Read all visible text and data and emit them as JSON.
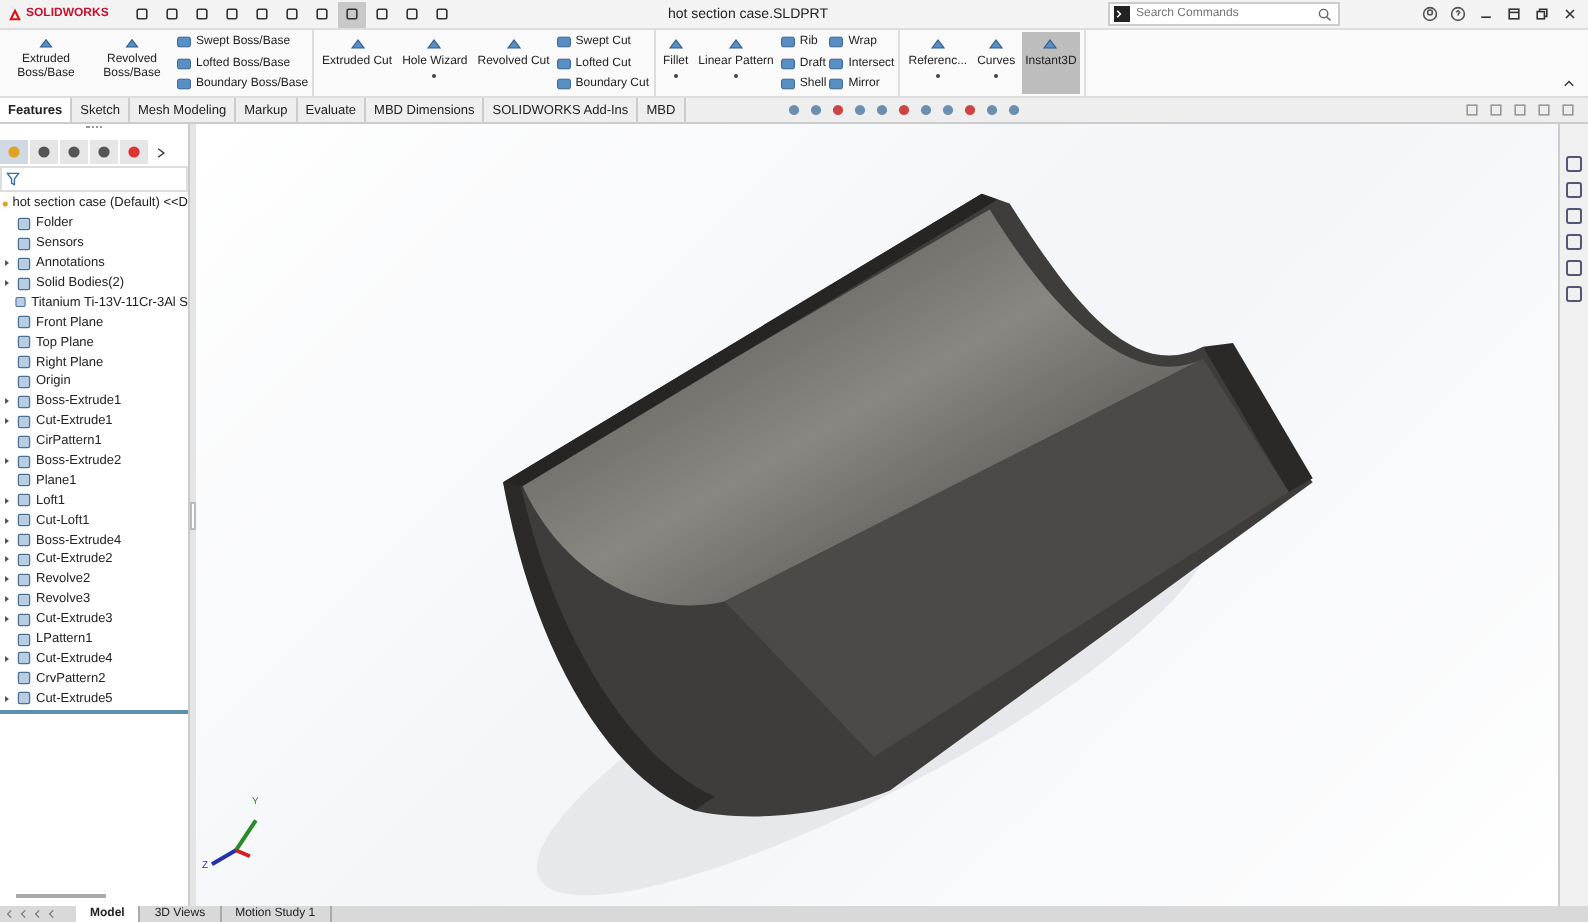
{
  "app": {
    "logo": "SOLIDWORKS"
  },
  "window": {
    "title": "hot section case.SLDPRT"
  },
  "quick_access": [
    {
      "selected": false
    },
    {
      "selected": false
    },
    {
      "selected": false
    },
    {
      "selected": false
    },
    {
      "selected": false
    },
    {
      "selected": false
    },
    {
      "selected": false
    },
    {
      "selected": true
    },
    {
      "selected": false
    },
    {
      "selected": false
    },
    {
      "selected": false
    }
  ],
  "search": {
    "placeholder": "Search Commands"
  },
  "ribbon": {
    "groups": [
      {
        "large": [
          {
            "label": "Extruded Boss/Base",
            "dropdown": false,
            "on": false
          },
          {
            "label": "Revolved Boss/Base",
            "dropdown": false,
            "on": false
          }
        ],
        "stacks": [
          [
            "Swept Boss/Base",
            "Lofted Boss/Base",
            "Boundary Boss/Base"
          ]
        ]
      },
      {
        "large": [
          {
            "label": "Extruded Cut",
            "dropdown": false,
            "on": false
          },
          {
            "label": "Hole Wizard",
            "dropdown": true,
            "on": false
          },
          {
            "label": "Revolved Cut",
            "dropdown": false,
            "on": false
          }
        ],
        "stacks": [
          [
            "Swept Cut",
            "Lofted Cut",
            "Boundary Cut"
          ]
        ]
      },
      {
        "large": [
          {
            "label": "Fillet",
            "dropdown": true,
            "on": false
          },
          {
            "label": "Linear Pattern",
            "dropdown": true,
            "on": false
          }
        ],
        "stacks": [
          [
            "Rib",
            "Draft",
            "Shell"
          ],
          [
            "Wrap",
            "Intersect",
            "Mirror"
          ]
        ]
      },
      {
        "large": [
          {
            "label": "Referenc...",
            "dropdown": true,
            "on": false
          },
          {
            "label": "Curves",
            "dropdown": true,
            "on": false
          },
          {
            "label": "Instant3D",
            "dropdown": false,
            "on": true
          }
        ]
      }
    ]
  },
  "command_tabs": [
    {
      "label": "Features",
      "selected": true
    },
    {
      "label": "Sketch",
      "selected": false
    },
    {
      "label": "Mesh Modeling",
      "selected": false
    },
    {
      "label": "Markup",
      "selected": false
    },
    {
      "label": "Evaluate",
      "selected": false
    },
    {
      "label": "MBD Dimensions",
      "selected": false
    },
    {
      "label": "SOLIDWORKS Add-Ins",
      "selected": false
    },
    {
      "label": "MBD",
      "selected": false
    }
  ],
  "panel_tabs": [
    {
      "selected": true
    },
    {
      "selected": false
    },
    {
      "selected": false
    },
    {
      "selected": false
    },
    {
      "selected": false
    }
  ],
  "feature_tree": {
    "root": "hot section case (Default) <<D",
    "items": [
      {
        "label": "Folder",
        "expandable": false
      },
      {
        "label": "Sensors",
        "expandable": false
      },
      {
        "label": "Annotations",
        "expandable": true
      },
      {
        "label": "Solid Bodies(2)",
        "expandable": true
      },
      {
        "label": "Titanium Ti-13V-11Cr-3Al S",
        "expandable": false
      },
      {
        "label": "Front Plane",
        "expandable": false
      },
      {
        "label": "Top Plane",
        "expandable": false
      },
      {
        "label": "Right Plane",
        "expandable": false
      },
      {
        "label": "Origin",
        "expandable": false
      },
      {
        "label": "Boss-Extrude1",
        "expandable": true
      },
      {
        "label": "Cut-Extrude1",
        "expandable": true
      },
      {
        "label": "CirPattern1",
        "expandable": false
      },
      {
        "label": "Boss-Extrude2",
        "expandable": true
      },
      {
        "label": "Plane1",
        "expandable": false
      },
      {
        "label": "Loft1",
        "expandable": true
      },
      {
        "label": "Cut-Loft1",
        "expandable": true
      },
      {
        "label": "Boss-Extrude4",
        "expandable": true
      },
      {
        "label": "Cut-Extrude2",
        "expandable": true
      },
      {
        "label": "Revolve2",
        "expandable": true
      },
      {
        "label": "Revolve3",
        "expandable": true
      },
      {
        "label": "Cut-Extrude3",
        "expandable": true
      },
      {
        "label": "LPattern1",
        "expandable": false
      },
      {
        "label": "Cut-Extrude4",
        "expandable": true
      },
      {
        "label": "CrvPattern2",
        "expandable": false
      },
      {
        "label": "Cut-Extrude5",
        "expandable": true
      }
    ]
  },
  "triad": {
    "y": "Y",
    "z": "Z"
  },
  "bottom_tabs": [
    {
      "label": "Model",
      "selected": true
    },
    {
      "label": "3D Views",
      "selected": false
    },
    {
      "label": "Motion Study 1",
      "selected": false
    }
  ]
}
